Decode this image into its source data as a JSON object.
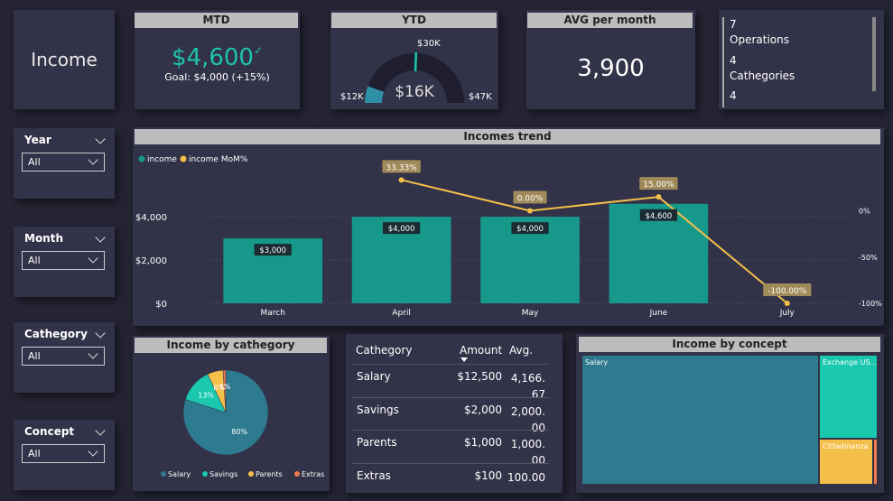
{
  "title": "Income",
  "kpis": {
    "mtd": {
      "header": "MTD",
      "value": "$4,600",
      "check": "✓",
      "goal": "Goal: $4,000 (+15%)"
    },
    "ytd": {
      "header": "YTD",
      "value": "$16K",
      "min": "$12K",
      "max": "$47K",
      "target": "$30K",
      "fraction": 0.11,
      "target_fraction": 0.51
    },
    "avg": {
      "header": "AVG per month",
      "value": "3,900"
    }
  },
  "summary": [
    {
      "count": "7",
      "label": "Operations"
    },
    {
      "count": "4",
      "label": "Cathegories"
    },
    {
      "count": "4",
      "label": ""
    }
  ],
  "slicers": [
    {
      "label": "Year",
      "value": "All"
    },
    {
      "label": "Month",
      "value": "All"
    },
    {
      "label": "Cathegory",
      "value": "All"
    },
    {
      "label": "Concept",
      "value": "All"
    }
  ],
  "colors": {
    "teal": "#16998a",
    "gold": "#f5c04a",
    "pie_blue": "#2e7a8f",
    "pie_teal": "#1ac8b0",
    "orange": "#ef7a4e"
  },
  "chart_data": [
    {
      "type": "bar",
      "title": "Incomes trend",
      "categories": [
        "March",
        "April",
        "May",
        "June",
        "July"
      ],
      "series": [
        {
          "name": "income",
          "values": [
            3000,
            4000,
            4000,
            4600,
            null
          ],
          "labels": [
            "$3,000",
            "$4,000",
            "$4,000",
            "$4,600",
            ""
          ]
        },
        {
          "name": "income MoM%",
          "values": [
            null,
            33.33,
            0.0,
            15.0,
            -100.0
          ],
          "labels": [
            "",
            "33.33%",
            "0.00%",
            "15.00%",
            "-100.00%"
          ]
        }
      ],
      "y_ticks": [
        "$4,000",
        "$2,000",
        "$0"
      ],
      "y_tick_values": [
        4000,
        2000,
        0
      ],
      "ylim": [
        0,
        4800
      ],
      "y2_ticks": [
        "0%",
        "-50%",
        "-100%"
      ],
      "y2_tick_values": [
        0,
        -50,
        -100
      ],
      "y2lim": [
        -100,
        20
      ],
      "legend": "top-left"
    },
    {
      "type": "pie",
      "title": "Income by cathegory",
      "labels": [
        "Salary",
        "Savings",
        "Parents",
        "Extras"
      ],
      "values": [
        80,
        13,
        6,
        1
      ],
      "slice_labels": [
        "80%",
        "13%",
        "6%",
        "1%"
      ],
      "legend": "bottom"
    },
    {
      "type": "table",
      "columns": [
        "Cathegory",
        "Amount",
        "Avg."
      ],
      "rows": [
        {
          "cat": "Salary",
          "amount": "$12,500",
          "avg": "4,166.67"
        },
        {
          "cat": "Savings",
          "amount": "$2,000",
          "avg": "2,000.00"
        },
        {
          "cat": "Parents",
          "amount": "$1,000",
          "avg": "1,000.00"
        },
        {
          "cat": "Extras",
          "amount": "$100",
          "avg": "100.00"
        }
      ]
    },
    {
      "type": "treemap",
      "title": "Income by concept",
      "items": [
        {
          "label": "Salary",
          "value": 12500
        },
        {
          "label": "Exchange US...",
          "value": 2000
        },
        {
          "label": "Cittadinanza",
          "value": 1000
        },
        {
          "label": "",
          "value": 100
        }
      ]
    }
  ]
}
